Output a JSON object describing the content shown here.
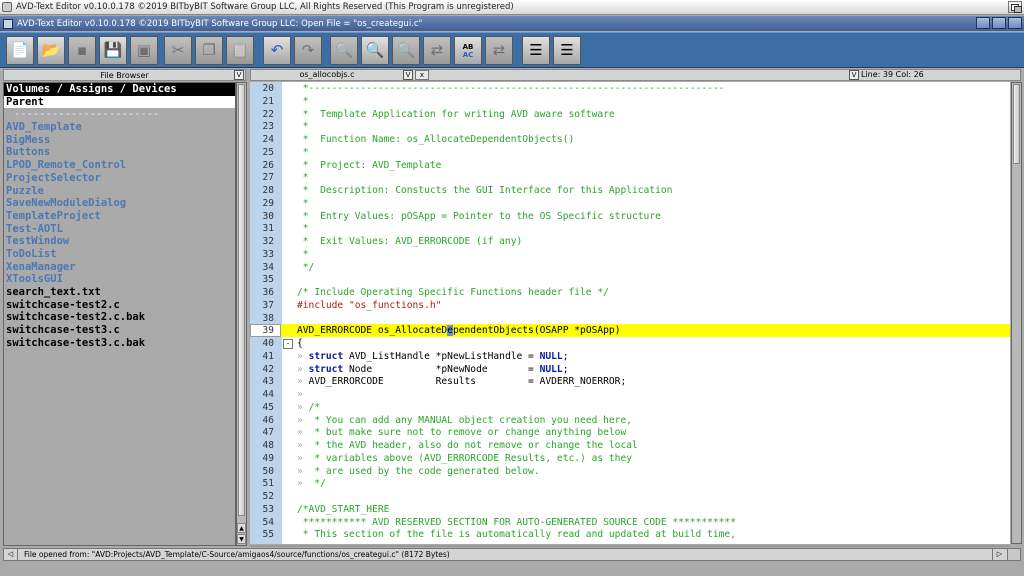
{
  "screen": {
    "title": "AVD-Text Editor v0.10.0.178 ©2019 BITbyBIT Software Group LLC, All Rights Reserved (This Program is unregistered)"
  },
  "window": {
    "title": "AVD-Text Editor v0.10.0.178 ©2019 BITbyBIT Software Group LLC: Open File = \"os_creategui.c\""
  },
  "toolbar": {
    "buttons": [
      {
        "icon": "new-file-icon"
      },
      {
        "icon": "open-folder-icon"
      },
      {
        "icon": "blank-icon"
      },
      {
        "icon": "save-icon"
      },
      {
        "icon": "save-all-icon"
      },
      {
        "icon": "cut-icon"
      },
      {
        "icon": "copy-icon"
      },
      {
        "icon": "paste-icon"
      },
      {
        "icon": "undo-icon"
      },
      {
        "icon": "redo-icon"
      },
      {
        "icon": "zoom-out-icon"
      },
      {
        "icon": "zoom-icon"
      },
      {
        "icon": "zoom-in-icon"
      },
      {
        "icon": "replace-icon"
      },
      {
        "icon": "replace-active-icon"
      },
      {
        "icon": "replace-all-icon"
      },
      {
        "icon": "indent-icon"
      },
      {
        "icon": "outdent-icon"
      }
    ],
    "replace_label_top": "AB",
    "replace_label_bottom": "AC"
  },
  "file_browser": {
    "header": "File Browser",
    "dropdown_glyph": "V",
    "items": [
      {
        "label": "Volumes / Assigns / Devices",
        "kind": "blk"
      },
      {
        "label": "Parent",
        "kind": "wht"
      },
      {
        "label": "-----------------------",
        "kind": "sep"
      },
      {
        "label": "AVD_Template",
        "kind": "dir"
      },
      {
        "label": "BigMess",
        "kind": "dir"
      },
      {
        "label": "Buttons",
        "kind": "dir"
      },
      {
        "label": "LPOD_Remote_Control",
        "kind": "dir"
      },
      {
        "label": "ProjectSelector",
        "kind": "dir"
      },
      {
        "label": "Puzzle",
        "kind": "dir"
      },
      {
        "label": "SaveNewModuleDialog",
        "kind": "dir"
      },
      {
        "label": "TemplateProject",
        "kind": "dir"
      },
      {
        "label": "Test-AOTL",
        "kind": "dir"
      },
      {
        "label": "TestWindow",
        "kind": "dir"
      },
      {
        "label": "ToDoList",
        "kind": "dir"
      },
      {
        "label": "XenaManager",
        "kind": "dir"
      },
      {
        "label": "XToolsGUI",
        "kind": "dir"
      },
      {
        "label": "search_text.txt",
        "kind": "file"
      },
      {
        "label": "switchcase-test2.c",
        "kind": "file"
      },
      {
        "label": "switchcase-test2.c.bak",
        "kind": "file"
      },
      {
        "label": "switchcase-test3.c",
        "kind": "file"
      },
      {
        "label": "switchcase-test3.c.bak",
        "kind": "file"
      }
    ]
  },
  "tabs": {
    "active_file": "os_allocobjs.c",
    "dropdown_glyph": "V",
    "close_label": "x",
    "position": "Line: 39 Col: 26"
  },
  "editor": {
    "lines": [
      {
        "n": "20",
        "t": " *------------------------------------------------------------------------",
        "c": "cm"
      },
      {
        "n": "21",
        "t": " *",
        "c": "cm"
      },
      {
        "n": "22",
        "t": " *  Template Application for writing AVD aware software",
        "c": "cm"
      },
      {
        "n": "23",
        "t": " *",
        "c": "cm"
      },
      {
        "n": "24",
        "t": " *  Function Name: os_AllocateDependentObjects()",
        "c": "cm"
      },
      {
        "n": "25",
        "t": " *",
        "c": "cm"
      },
      {
        "n": "26",
        "t": " *  Project: AVD_Template",
        "c": "cm"
      },
      {
        "n": "27",
        "t": " *",
        "c": "cm"
      },
      {
        "n": "28",
        "t": " *  Description: Constucts the GUI Interface for this Application",
        "c": "cm"
      },
      {
        "n": "29",
        "t": " *",
        "c": "cm"
      },
      {
        "n": "30",
        "t": " *  Entry Values: pOSApp = Pointer to the OS Specific structure",
        "c": "cm"
      },
      {
        "n": "31",
        "t": " *",
        "c": "cm"
      },
      {
        "n": "32",
        "t": " *  Exit Values: AVD_ERRORCODE (if any)",
        "c": "cm"
      },
      {
        "n": "33",
        "t": " *",
        "c": "cm"
      },
      {
        "n": "34",
        "t": " */",
        "c": "cm"
      },
      {
        "n": "35",
        "t": "",
        "c": "cm"
      },
      {
        "n": "36",
        "t": "/* Include Operating Specific Functions header file */",
        "c": "cm"
      },
      {
        "n": "37",
        "t": "",
        "c": "pp"
      },
      {
        "n": "38",
        "t": "",
        "c": "cm"
      },
      {
        "n": "39",
        "t": "",
        "c": "hl"
      },
      {
        "n": "40",
        "t": "{",
        "c": "plain"
      },
      {
        "n": "41",
        "t": "",
        "c": "kwline"
      },
      {
        "n": "42",
        "t": "",
        "c": "kwline"
      },
      {
        "n": "43",
        "t": "",
        "c": "plain"
      },
      {
        "n": "44",
        "t": "",
        "c": "plain"
      },
      {
        "n": "45",
        "t": "/*",
        "c": "cmtab"
      },
      {
        "n": "46",
        "t": " * You can add any MANUAL object creation you need here,",
        "c": "cmtab"
      },
      {
        "n": "47",
        "t": " * but make sure not to remove or change anything below",
        "c": "cmtab"
      },
      {
        "n": "48",
        "t": " * the AVD header, also do not remove or change the local",
        "c": "cmtab"
      },
      {
        "n": "49",
        "t": " * variables above (AVD_ERRORCODE Results, etc.) as they",
        "c": "cmtab"
      },
      {
        "n": "50",
        "t": " * are used by the code generated below.",
        "c": "cmtab"
      },
      {
        "n": "51",
        "t": " */",
        "c": "cmtab"
      },
      {
        "n": "52",
        "t": "",
        "c": "plain"
      },
      {
        "n": "53",
        "t": "/*AVD_START_HERE",
        "c": "cm"
      },
      {
        "n": "54",
        "t": " *********** AVD RESERVED SECTION FOR AUTO-GENERATED SOURCE CODE ***********",
        "c": "cm"
      },
      {
        "n": "55",
        "t": " * This section of the file is automatically read and updated at build time,",
        "c": "cm"
      }
    ],
    "include_directive": "#include ",
    "include_file": "\"os_functions.h\"",
    "line39_before_caret": "AVD_ERRORCODE os_AllocateD",
    "line39_caret": "e",
    "line39_after_caret": "pendentObjects(OSAPP *pOSApp)",
    "tab_glyph": "»",
    "fold_glyph": "-",
    "line41_kw": "struct",
    "line41_rest": " AVD_ListHandle *pNewListHandle = ",
    "line42_kw": "struct",
    "line42_rest": " Node           *pNewNode       = ",
    "null_kw": "NULL",
    "semicolon": ";",
    "line43_text": "AVD_ERRORCODE         Results         = AVDERR_NOERROR;"
  },
  "status": {
    "left_arrow": "◁",
    "text": "File opened from: \"AVD:Projects/AVD_Template/C-Source/amigaos4/source/functions/os_creategui.c\" (8172 Bytes)",
    "right_arrow": "▷"
  }
}
